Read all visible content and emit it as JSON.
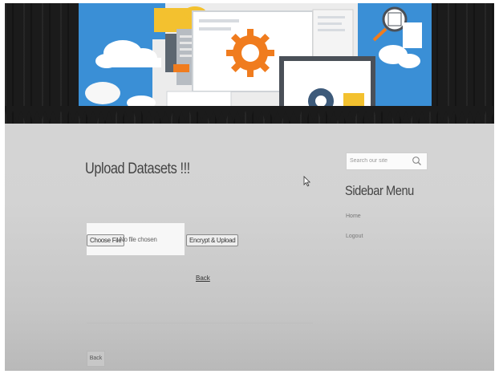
{
  "main": {
    "title": "Upload Datasets !!!",
    "file_button_label": "Choose File",
    "file_status": "No file chosen",
    "submit_label": "Encrypt & Upload",
    "back_link": "Back",
    "back_button": "Back"
  },
  "sidebar": {
    "search_placeholder": "Search our site",
    "title": "Sidebar Menu",
    "links": [
      "Home",
      "Logout"
    ]
  },
  "icons": [
    "search-icon",
    "gear-icon",
    "cloud-icon",
    "mouse-cursor-icon"
  ],
  "colors": {
    "header_background": "#1b1b1b",
    "page_background": "#d3d3d3",
    "banner_sky": "#3a8fd6",
    "banner_orange": "#f07c1e",
    "banner_yellow": "#f3c12f"
  }
}
